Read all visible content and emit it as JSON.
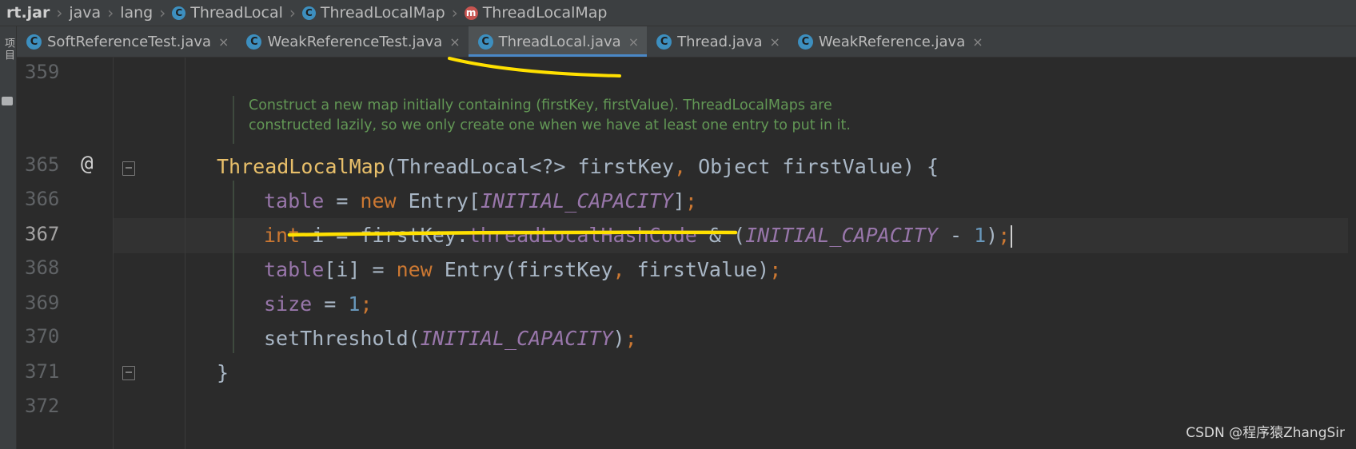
{
  "breadcrumb": [
    {
      "label": "rt.jar",
      "icon": null
    },
    {
      "label": "java",
      "icon": null
    },
    {
      "label": "lang",
      "icon": null
    },
    {
      "label": "ThreadLocal",
      "icon": "class-icon"
    },
    {
      "label": "ThreadLocalMap",
      "icon": "inner-class-icon"
    },
    {
      "label": "ThreadLocalMap",
      "icon": "method-icon"
    }
  ],
  "icon_glyphs": {
    "class": "C",
    "method": "m"
  },
  "left_strip": {
    "project_label": "项目"
  },
  "tabs": [
    {
      "label": "SoftReferenceTest.java",
      "close": "×",
      "active": false
    },
    {
      "label": "WeakReferenceTest.java",
      "close": "×",
      "active": false
    },
    {
      "label": "ThreadLocal.java",
      "close": "×",
      "active": true
    },
    {
      "label": "Thread.java",
      "close": "×",
      "active": false
    },
    {
      "label": "WeakReference.java",
      "close": "×",
      "active": false
    }
  ],
  "editor": {
    "line_numbers": [
      "359",
      "365",
      "366",
      "367",
      "368",
      "369",
      "370",
      "371",
      "372"
    ],
    "current_line": "367",
    "gutter_marker": "@",
    "doc_comment": [
      "Construct a new map initially containing (firstKey, firstValue). ThreadLocalMaps are",
      "constructed lazily, so we only create one when we have at least one entry to put in it."
    ],
    "code": {
      "l365": {
        "name": "ThreadLocalMap",
        "open": "(ThreadLocal<?> firstKey",
        "comma": ",",
        "rest": " Object firstValue) {"
      },
      "l366": {
        "fld": "table",
        "eq": " = ",
        "kw": "new",
        "type": " Entry[",
        "cst": "INITIAL_CAPACITY",
        "close": "]",
        "semi": ";"
      },
      "l367": {
        "kw": "int",
        "a": " i = firstKey.",
        "fld": "threadLocalHashCode",
        "b": " & (",
        "cst": "INITIAL_CAPACITY",
        "c": " - ",
        "num": "1",
        "d": ")",
        "semi": ";"
      },
      "l368": {
        "fld": "table",
        "a": "[i] = ",
        "kw": "new",
        "b": " Entry(firstKey",
        "comma": ",",
        "c": " firstValue)",
        "semi": ";"
      },
      "l369": {
        "fld": "size",
        "a": " = ",
        "num": "1",
        "semi": ";"
      },
      "l370": {
        "a": "setThreshold(",
        "cst": "INITIAL_CAPACITY",
        "b": ")",
        "semi": ";"
      },
      "l371": {
        "a": "}"
      }
    }
  },
  "watermark": "CSDN @程序猿ZhangSir",
  "colors": {
    "keyword": "#cc7832",
    "field": "#9876aa",
    "number": "#6897bb",
    "doc": "#629755",
    "annotation_marker": "#ffe000"
  }
}
